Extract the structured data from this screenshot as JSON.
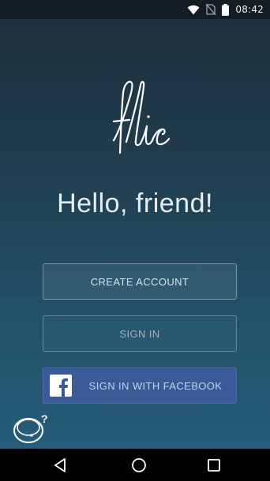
{
  "status_bar": {
    "time": "08:42",
    "icons": [
      "wifi-icon",
      "no-sim-icon",
      "battery-icon"
    ]
  },
  "app": {
    "logo_text": "flic",
    "greeting": "Hello, friend!"
  },
  "buttons": {
    "create_account": "CREATE ACCOUNT",
    "sign_in": "SIGN IN",
    "facebook": "SIGN IN WITH FACEBOOK"
  },
  "help": {
    "icon": "flic-button-help-icon",
    "symbol": "?"
  },
  "nav_bar": {
    "icons": [
      "back-icon",
      "home-icon",
      "recents-icon"
    ]
  },
  "colors": {
    "background_top": "#1d2f3d",
    "background_bottom": "#265d78",
    "facebook_blue": "#3b5a98",
    "text_light": "#e6eef2"
  }
}
